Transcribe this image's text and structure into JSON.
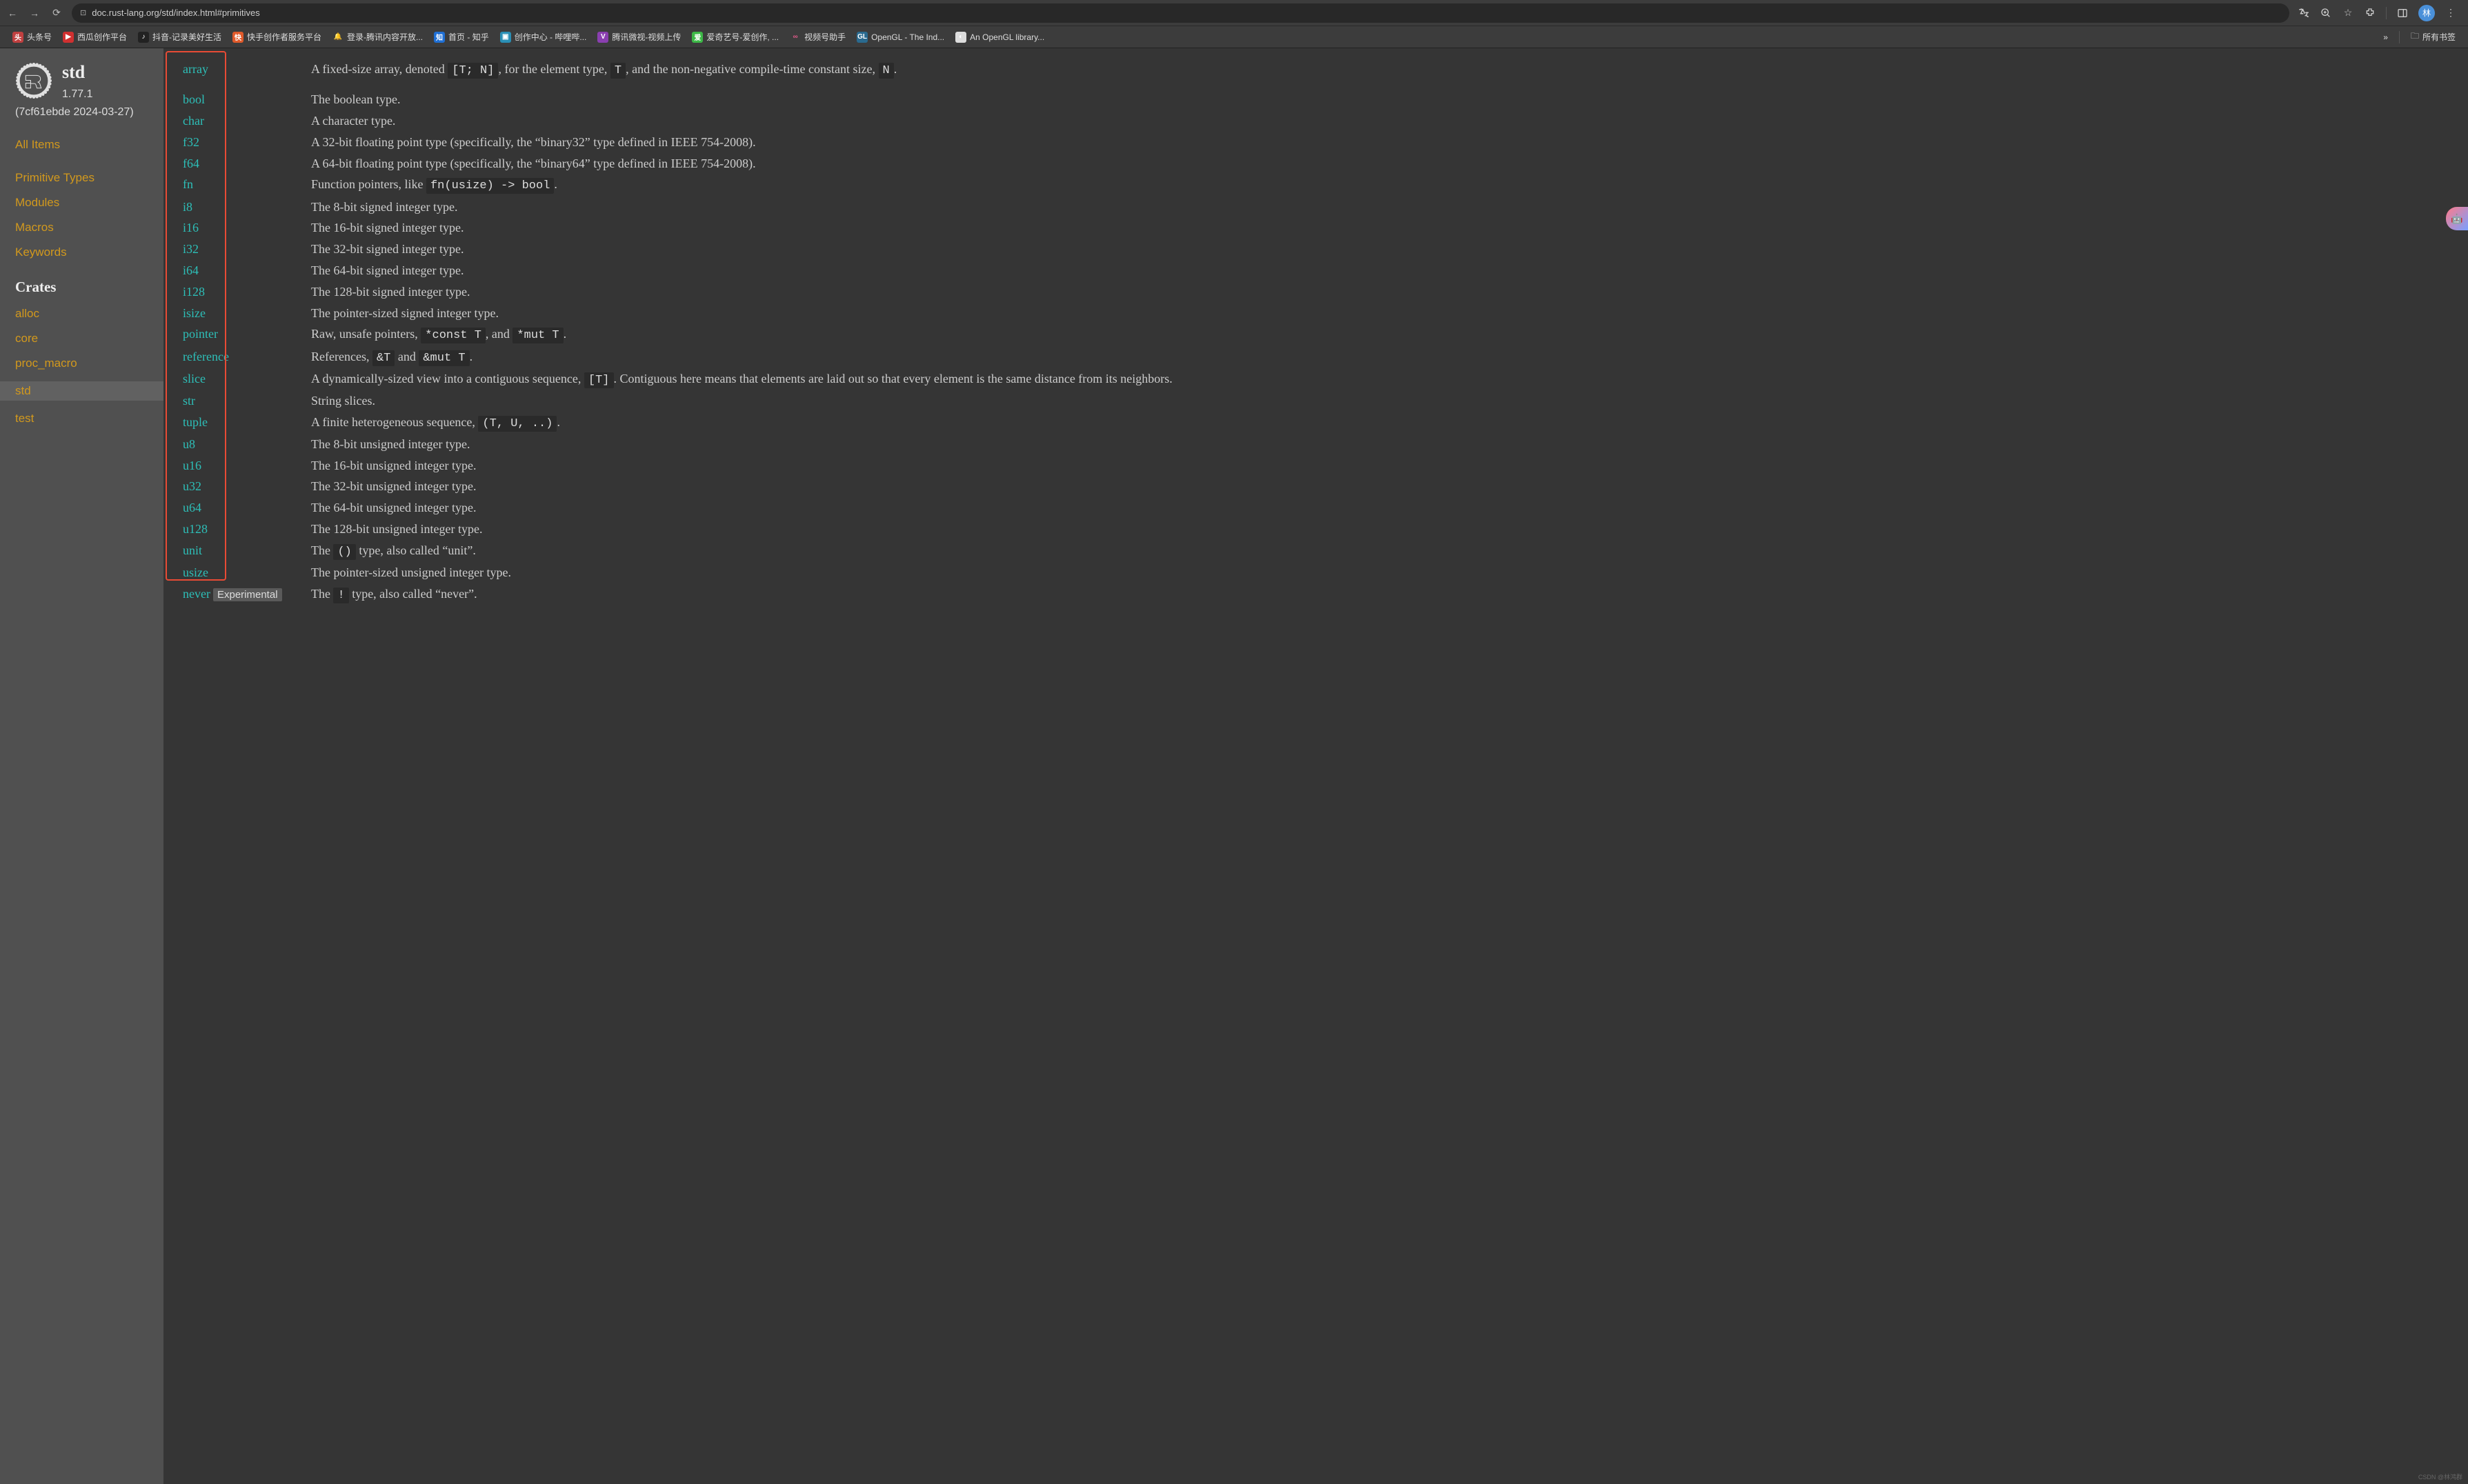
{
  "url": "doc.rust-lang.org/std/index.html#primitives",
  "bookmarks": [
    {
      "ico": "头",
      "bg": "#c04040",
      "label": "头条号"
    },
    {
      "ico": "▶",
      "bg": "#d03030",
      "label": "西瓜创作平台"
    },
    {
      "ico": "♪",
      "bg": "#222",
      "label": "抖音-记录美好生活"
    },
    {
      "ico": "快",
      "bg": "#e05a2b",
      "label": "快手创作者服务平台"
    },
    {
      "ico": "🔔",
      "bg": "transparent",
      "label": "登录-腾讯内容开放..."
    },
    {
      "ico": "知",
      "bg": "#1f6fd4",
      "label": "首页 - 知乎"
    },
    {
      "ico": "▣",
      "bg": "#2a8fb5",
      "label": "创作中心 - 哔哩哔..."
    },
    {
      "ico": "V",
      "bg": "#8a3fb0",
      "label": "腾讯微视-视频上传"
    },
    {
      "ico": "爱",
      "bg": "#3db847",
      "label": "爱奇艺号-爱创作, ..."
    },
    {
      "ico": "∞",
      "bg": "transparent",
      "label": "视频号助手",
      "fg": "#e05a8a"
    },
    {
      "ico": "GL",
      "bg": "#2a6a8f",
      "label": "OpenGL - The Ind..."
    },
    {
      "ico": "◐",
      "bg": "#ddd",
      "label": "An OpenGL library..."
    }
  ],
  "bookmark_overflow": "»",
  "all_bookmarks": "所有书签",
  "sidebar": {
    "crate": "std",
    "version": "1.77.1",
    "hash": "(7cf61ebde 2024-03-27)",
    "all_items": "All Items",
    "sections": [
      "Primitive Types",
      "Modules",
      "Macros",
      "Keywords"
    ],
    "crates_head": "Crates",
    "crates": [
      "alloc",
      "core",
      "proc_macro",
      "std",
      "test"
    ]
  },
  "rows": [
    {
      "name": "array",
      "desc": "A fixed-size array, denoted |[T; N]|, for the element type, |T|, and the non-negative compile-time constant size, |N|."
    },
    {
      "name": "bool",
      "desc": "The boolean type."
    },
    {
      "name": "char",
      "desc": "A character type."
    },
    {
      "name": "f32",
      "desc": "A 32-bit floating point type (specifically, the “binary32” type defined in IEEE 754-2008)."
    },
    {
      "name": "f64",
      "desc": "A 64-bit floating point type (specifically, the “binary64” type defined in IEEE 754-2008)."
    },
    {
      "name": "fn",
      "desc": "Function pointers, like |fn(usize) -> bool|."
    },
    {
      "name": "i8",
      "desc": "The 8-bit signed integer type."
    },
    {
      "name": "i16",
      "desc": "The 16-bit signed integer type."
    },
    {
      "name": "i32",
      "desc": "The 32-bit signed integer type."
    },
    {
      "name": "i64",
      "desc": "The 64-bit signed integer type."
    },
    {
      "name": "i128",
      "desc": "The 128-bit signed integer type."
    },
    {
      "name": "isize",
      "desc": "The pointer-sized signed integer type."
    },
    {
      "name": "pointer",
      "desc": "Raw, unsafe pointers, |*const T|, and |*mut T|."
    },
    {
      "name": "reference",
      "desc": "References, |&T| and |&mut T|."
    },
    {
      "name": "slice",
      "desc": "A dynamically-sized view into a contiguous sequence, |[T]|. Contiguous here means that elements are laid out so that every element is the same distance from its neighbors."
    },
    {
      "name": "str",
      "desc": "String slices."
    },
    {
      "name": "tuple",
      "desc": "A finite heterogeneous sequence, |(T, U, ..)|."
    },
    {
      "name": "u8",
      "desc": "The 8-bit unsigned integer type."
    },
    {
      "name": "u16",
      "desc": "The 16-bit unsigned integer type."
    },
    {
      "name": "u32",
      "desc": "The 32-bit unsigned integer type."
    },
    {
      "name": "u64",
      "desc": "The 64-bit unsigned integer type."
    },
    {
      "name": "u128",
      "desc": "The 128-bit unsigned integer type."
    },
    {
      "name": "unit",
      "desc": "The |()| type, also called “unit”."
    },
    {
      "name": "usize",
      "desc": "The pointer-sized unsigned integer type."
    },
    {
      "name": "never",
      "badge": "Experimental",
      "desc": "The |!| type, also called “never”."
    }
  ],
  "watermark": "CSDN @林鸿群"
}
